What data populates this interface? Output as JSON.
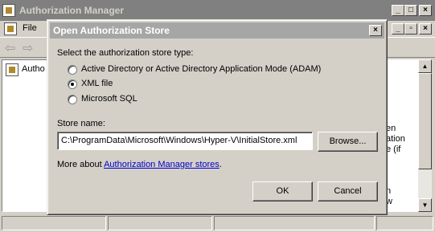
{
  "main_window": {
    "title": "Authorization Manager",
    "menu": {
      "file": "File"
    },
    "tree_item": "Autho",
    "right_text": [
      "en",
      "ation",
      "e (if",
      "n",
      "w"
    ]
  },
  "dialog": {
    "title": "Open Authorization Store",
    "store_type_label": "Select the authorization store type:",
    "options": [
      {
        "label": "Active Directory or Active Directory Application Mode (ADAM)",
        "selected": false
      },
      {
        "label": "XML file",
        "selected": true
      },
      {
        "label": "Microsoft SQL",
        "selected": false
      }
    ],
    "store_name_label": "Store name:",
    "store_name_value": "C:\\ProgramData\\Microsoft\\Windows\\Hyper-V\\InitialStore.xml",
    "browse_label": "Browse...",
    "more_about_prefix": "More about ",
    "more_about_link": "Authorization Manager stores",
    "more_about_suffix": ".",
    "ok_label": "OK",
    "cancel_label": "Cancel"
  },
  "icons": [
    "app-icon",
    "back-arrow-icon",
    "forward-arrow-icon",
    "minimize-icon",
    "maximize-icon",
    "close-icon"
  ]
}
